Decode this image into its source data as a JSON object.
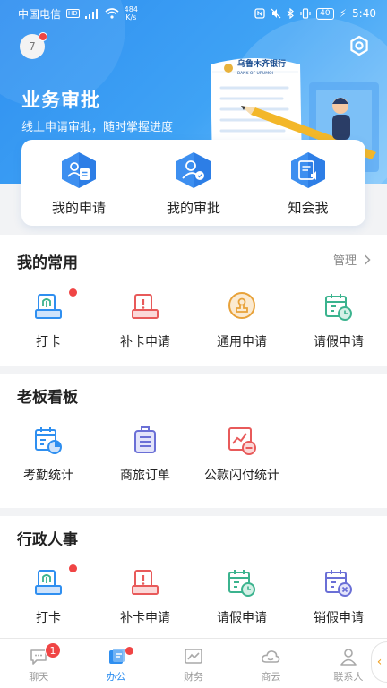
{
  "status_bar": {
    "carrier": "中国电信",
    "hd": "HD",
    "speed_value": "484",
    "speed_unit": "K/s",
    "battery": "40",
    "time": "5:40"
  },
  "header": {
    "avatar_text": "7",
    "title": "业务审批",
    "subtitle": "线上申请审批，随时掌握进度",
    "bank_name_cn": "乌鲁木齐银行",
    "bank_name_en": "BANK OF URUMQI"
  },
  "quick_actions": [
    {
      "label": "我的申请",
      "icon": "document-person-icon"
    },
    {
      "label": "我的审批",
      "icon": "person-approve-icon"
    },
    {
      "label": "知会我",
      "icon": "notify-document-icon"
    }
  ],
  "common": {
    "title": "我的常用",
    "manage_label": "管理",
    "items": [
      {
        "label": "打卡",
        "icon": "fingerprint-clock-icon",
        "dot": true
      },
      {
        "label": "补卡申请",
        "icon": "supplement-card-icon",
        "dot": false
      },
      {
        "label": "通用申请",
        "icon": "stamp-icon",
        "dot": false
      },
      {
        "label": "请假申请",
        "icon": "calendar-leave-icon",
        "dot": false
      }
    ]
  },
  "boss": {
    "title": "老板看板",
    "items": [
      {
        "label": "考勤统计",
        "icon": "calendar-stats-icon"
      },
      {
        "label": "商旅订单",
        "icon": "luggage-icon"
      },
      {
        "label": "公款闪付统计",
        "icon": "payment-chart-icon"
      }
    ]
  },
  "admin": {
    "title": "行政人事",
    "items": [
      {
        "label": "打卡",
        "icon": "fingerprint-clock-icon",
        "dot": true
      },
      {
        "label": "补卡申请",
        "icon": "supplement-card-icon",
        "dot": false
      },
      {
        "label": "请假申请",
        "icon": "calendar-leave-icon",
        "dot": false
      },
      {
        "label": "销假申请",
        "icon": "calendar-cancel-icon",
        "dot": false
      }
    ]
  },
  "tabs": [
    {
      "label": "聊天",
      "icon": "chat-icon",
      "badge": "1",
      "active": false
    },
    {
      "label": "办公",
      "icon": "office-icon",
      "badge": "",
      "active": true
    },
    {
      "label": "财务",
      "icon": "finance-chart-icon",
      "badge": "",
      "active": false
    },
    {
      "label": "商云",
      "icon": "cloud-icon",
      "badge": "",
      "active": false
    },
    {
      "label": "联系人",
      "icon": "contacts-icon",
      "badge": "",
      "active": false
    }
  ],
  "colors": {
    "primary": "#2f8ff0",
    "red": "#f04545",
    "green": "#3bb38e",
    "orange": "#e8a23a",
    "purple": "#6a6fd6"
  }
}
